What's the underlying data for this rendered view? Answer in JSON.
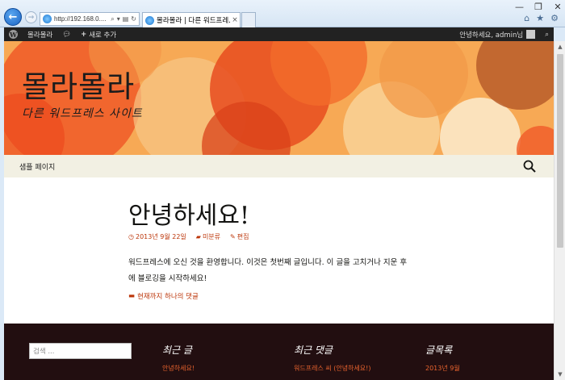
{
  "browser": {
    "address": "http://192.168.0....",
    "tab_title": "몰라몰라 | 다른 워드프레...",
    "tab_close": "×",
    "win_controls": {
      "minimize": "—",
      "restore": "❐",
      "close": "✕"
    },
    "tool_icons": {
      "home": "⌂",
      "favorites": "★",
      "settings": "⚙"
    }
  },
  "adminbar": {
    "site_name": "몰라몰라",
    "new_label": "새로 추가",
    "greeting": "안녕하세요, admin님"
  },
  "site": {
    "title": "몰라몰라",
    "description": "다른 워드프레스 사이트"
  },
  "nav": {
    "items": [
      "샘플 페이지"
    ]
  },
  "post": {
    "title": "안녕하세요!",
    "date": "2013년 9월 22일",
    "category": "미분류",
    "edit": "편집",
    "body_line1": "워드프레스에 오신 것을 환영합니다. 이것은 첫번째 글입니다. 이 글을 고치거나 지운 후",
    "body_line2": "에 블로깅을 시작하세요!",
    "comments": "현재까지 하나의 댓글"
  },
  "footer": {
    "search_placeholder": "검색 ...",
    "widgets": [
      {
        "title": "최근 글",
        "link": "안녕하세요!"
      },
      {
        "title": "최근 댓글",
        "link": "워드프레스 씨 (안녕하세요!)"
      },
      {
        "title": "글목록",
        "link": "2013년 9월"
      }
    ]
  },
  "colors": {
    "accent": "#bc360a",
    "header_bg": "#f7b05a",
    "navbar_bg": "#f2f0e3",
    "footer_bg": "#220e10",
    "adminbar_bg": "#222222"
  }
}
